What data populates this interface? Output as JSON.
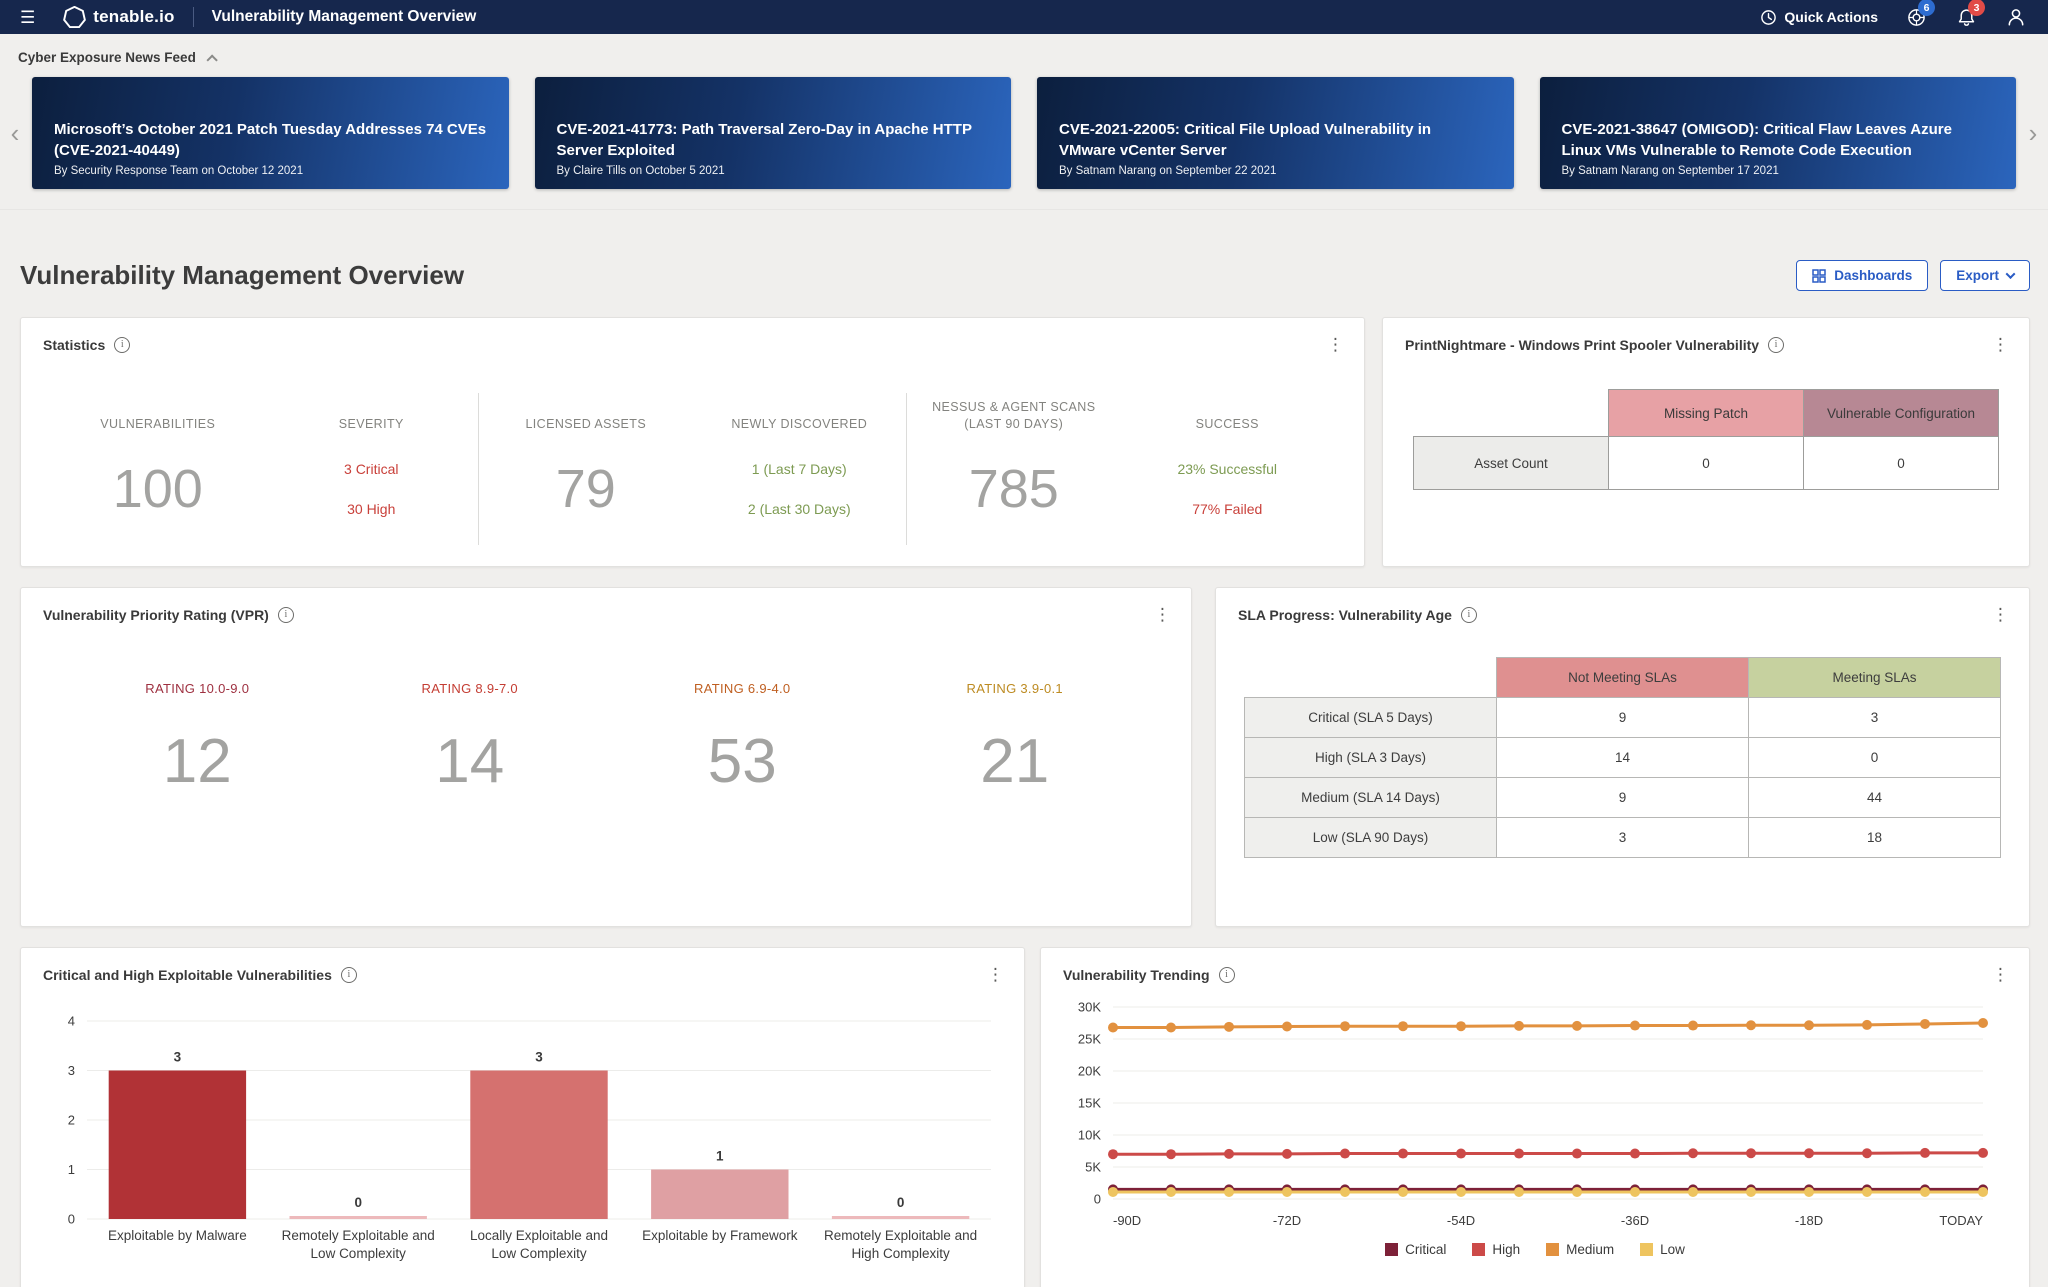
{
  "nav": {
    "brand": "tenable.io",
    "title": "Vulnerability Management Overview",
    "quick_actions_label": "Quick Actions",
    "help_badge": "6",
    "notifications_badge": "3"
  },
  "colors": {
    "nav_bg": "#16274d",
    "accent_blue": "#2a5cc5",
    "badge_blue": "#2d6cd0",
    "badge_red": "#e14b47",
    "severity_red": "#c9403a",
    "success_green": "#7d9b52",
    "card_gradient_start": "#0c1f3e",
    "card_gradient_end": "#2b65bd"
  },
  "news_feed": {
    "title": "Cyber Exposure News Feed",
    "cards": [
      {
        "title": "Microsoft’s October 2021 Patch Tuesday Addresses 74 CVEs (CVE-2021-40449)",
        "byline": "By Security Response Team on October 12 2021"
      },
      {
        "title": "CVE-2021-41773: Path Traversal Zero-Day in Apache HTTP Server Exploited",
        "byline": "By Claire Tills on October 5 2021"
      },
      {
        "title": "CVE-2021-22005: Critical File Upload Vulnerability in VMware vCenter Server",
        "byline": "By Satnam Narang on September 22 2021"
      },
      {
        "title": "CVE-2021-38647 (OMIGOD): Critical Flaw Leaves Azure Linux VMs Vulnerable to Remote Code Execution",
        "byline": "By Satnam Narang on September 17 2021"
      }
    ]
  },
  "page": {
    "title": "Vulnerability Management Overview",
    "dashboards_button": "Dashboards",
    "export_button": "Export"
  },
  "statistics": {
    "title": "Statistics",
    "vulnerabilities_label": "VULNERABILITIES",
    "vulnerabilities_value": "100",
    "severity_label": "SEVERITY",
    "severity_critical": "3 Critical",
    "severity_high": "30 High",
    "licensed_assets_label": "LICENSED ASSETS",
    "licensed_assets_value": "79",
    "newly_discovered_label": "NEWLY DISCOVERED",
    "newly_7d": "1 (Last 7 Days)",
    "newly_30d": "2 (Last 30 Days)",
    "scans_label_line1": "NESSUS & AGENT SCANS",
    "scans_label_line2": "(LAST 90 DAYS)",
    "scans_value": "785",
    "success_label": "SUCCESS",
    "success_ok": "23% Successful",
    "success_fail": "77% Failed"
  },
  "printnightmare": {
    "title": "PrintNightmare - Windows Print Spooler Vulnerability",
    "col_headers": [
      "Missing Patch",
      "Vulnerable Configuration"
    ],
    "header_colors": {
      "missing_patch": "#e7a1a5",
      "vulnerable_config": "#b78894"
    },
    "row_label": "Asset Count",
    "values": [
      "0",
      "0"
    ]
  },
  "vpr": {
    "title": "Vulnerability Priority Rating (VPR)",
    "ratings": [
      {
        "label": "RATING 10.0-9.0",
        "value": "12",
        "color": "#9e3040"
      },
      {
        "label": "RATING 8.9-7.0",
        "value": "14",
        "color": "#c43d33"
      },
      {
        "label": "RATING 6.9-4.0",
        "value": "53",
        "color": "#bf5f21"
      },
      {
        "label": "RATING 3.9-0.1",
        "value": "21",
        "color": "#bd8b22"
      }
    ]
  },
  "sla": {
    "title": "SLA Progress: Vulnerability Age",
    "col_headers": [
      "Not Meeting SLAs",
      "Meeting SLAs"
    ],
    "header_colors": {
      "not_meeting": "#df9090",
      "meeting": "#c6d19f"
    },
    "rows": [
      {
        "label": "Critical (SLA 5 Days)",
        "not_meeting": "9",
        "meeting": "3"
      },
      {
        "label": "High (SLA 3 Days)",
        "not_meeting": "14",
        "meeting": "0"
      },
      {
        "label": "Medium (SLA 14 Days)",
        "not_meeting": "9",
        "meeting": "44"
      },
      {
        "label": "Low (SLA 90 Days)",
        "not_meeting": "3",
        "meeting": "18"
      }
    ]
  },
  "chart_data": [
    {
      "id": "exploitable",
      "type": "bar",
      "title": "Critical and High Exploitable Vulnerabilities",
      "categories": [
        "Exploitable by Malware",
        "Remotely Exploitable and Low Complexity",
        "Locally Exploitable and Low Complexity",
        "Exploitable by Framework",
        "Remotely Exploitable and High Complexity"
      ],
      "category_lines": [
        [
          "Exploitable by Malware"
        ],
        [
          "Remotely Exploitable and",
          "Low Complexity"
        ],
        [
          "Locally Exploitable and",
          "Low Complexity"
        ],
        [
          "Exploitable by Framework"
        ],
        [
          "Remotely Exploitable and",
          "High Complexity"
        ]
      ],
      "values": [
        3,
        0,
        3,
        1,
        0
      ],
      "bar_colors": [
        "#b13236",
        "#edb9bb",
        "#d5716f",
        "#dfa0a3",
        "#edb9bb"
      ],
      "ylim": [
        0,
        4
      ],
      "yticks": [
        0,
        1,
        2,
        3,
        4
      ],
      "grid": true,
      "xlabel": "",
      "ylabel": ""
    },
    {
      "id": "trending",
      "type": "line",
      "title": "Vulnerability Trending",
      "n_points": 16,
      "x_labels": [
        "-90D",
        "-72D",
        "-54D",
        "-36D",
        "-18D",
        "TODAY"
      ],
      "x_label_indices": [
        0,
        3,
        6,
        9,
        12,
        15
      ],
      "ylim": [
        0,
        30000
      ],
      "yticks": [
        0,
        5000,
        10000,
        15000,
        20000,
        25000,
        30000
      ],
      "ytick_labels": [
        "0",
        "5K",
        "10K",
        "15K",
        "20K",
        "25K",
        "30K"
      ],
      "grid": true,
      "series": [
        {
          "name": "Critical",
          "color": "#7d2138",
          "values": [
            1500,
            1500,
            1500,
            1500,
            1500,
            1500,
            1500,
            1500,
            1500,
            1500,
            1500,
            1500,
            1500,
            1500,
            1500,
            1500
          ]
        },
        {
          "name": "High",
          "color": "#cc4a48",
          "values": [
            7000,
            7000,
            7050,
            7050,
            7100,
            7100,
            7100,
            7100,
            7100,
            7100,
            7150,
            7150,
            7150,
            7150,
            7200,
            7200
          ]
        },
        {
          "name": "Medium",
          "color": "#e2913f",
          "values": [
            26800,
            26800,
            26900,
            26950,
            27000,
            27000,
            27000,
            27050,
            27050,
            27100,
            27100,
            27150,
            27150,
            27200,
            27350,
            27500
          ]
        },
        {
          "name": "Low",
          "color": "#eec45f",
          "values": [
            1100,
            1100,
            1100,
            1100,
            1100,
            1100,
            1100,
            1100,
            1100,
            1100,
            1100,
            1100,
            1100,
            1100,
            1100,
            1100
          ]
        }
      ],
      "z_order": [
        "Medium",
        "High",
        "Critical",
        "Low"
      ],
      "legend": [
        "Critical",
        "High",
        "Medium",
        "Low"
      ],
      "legend_position": "bottom"
    }
  ]
}
